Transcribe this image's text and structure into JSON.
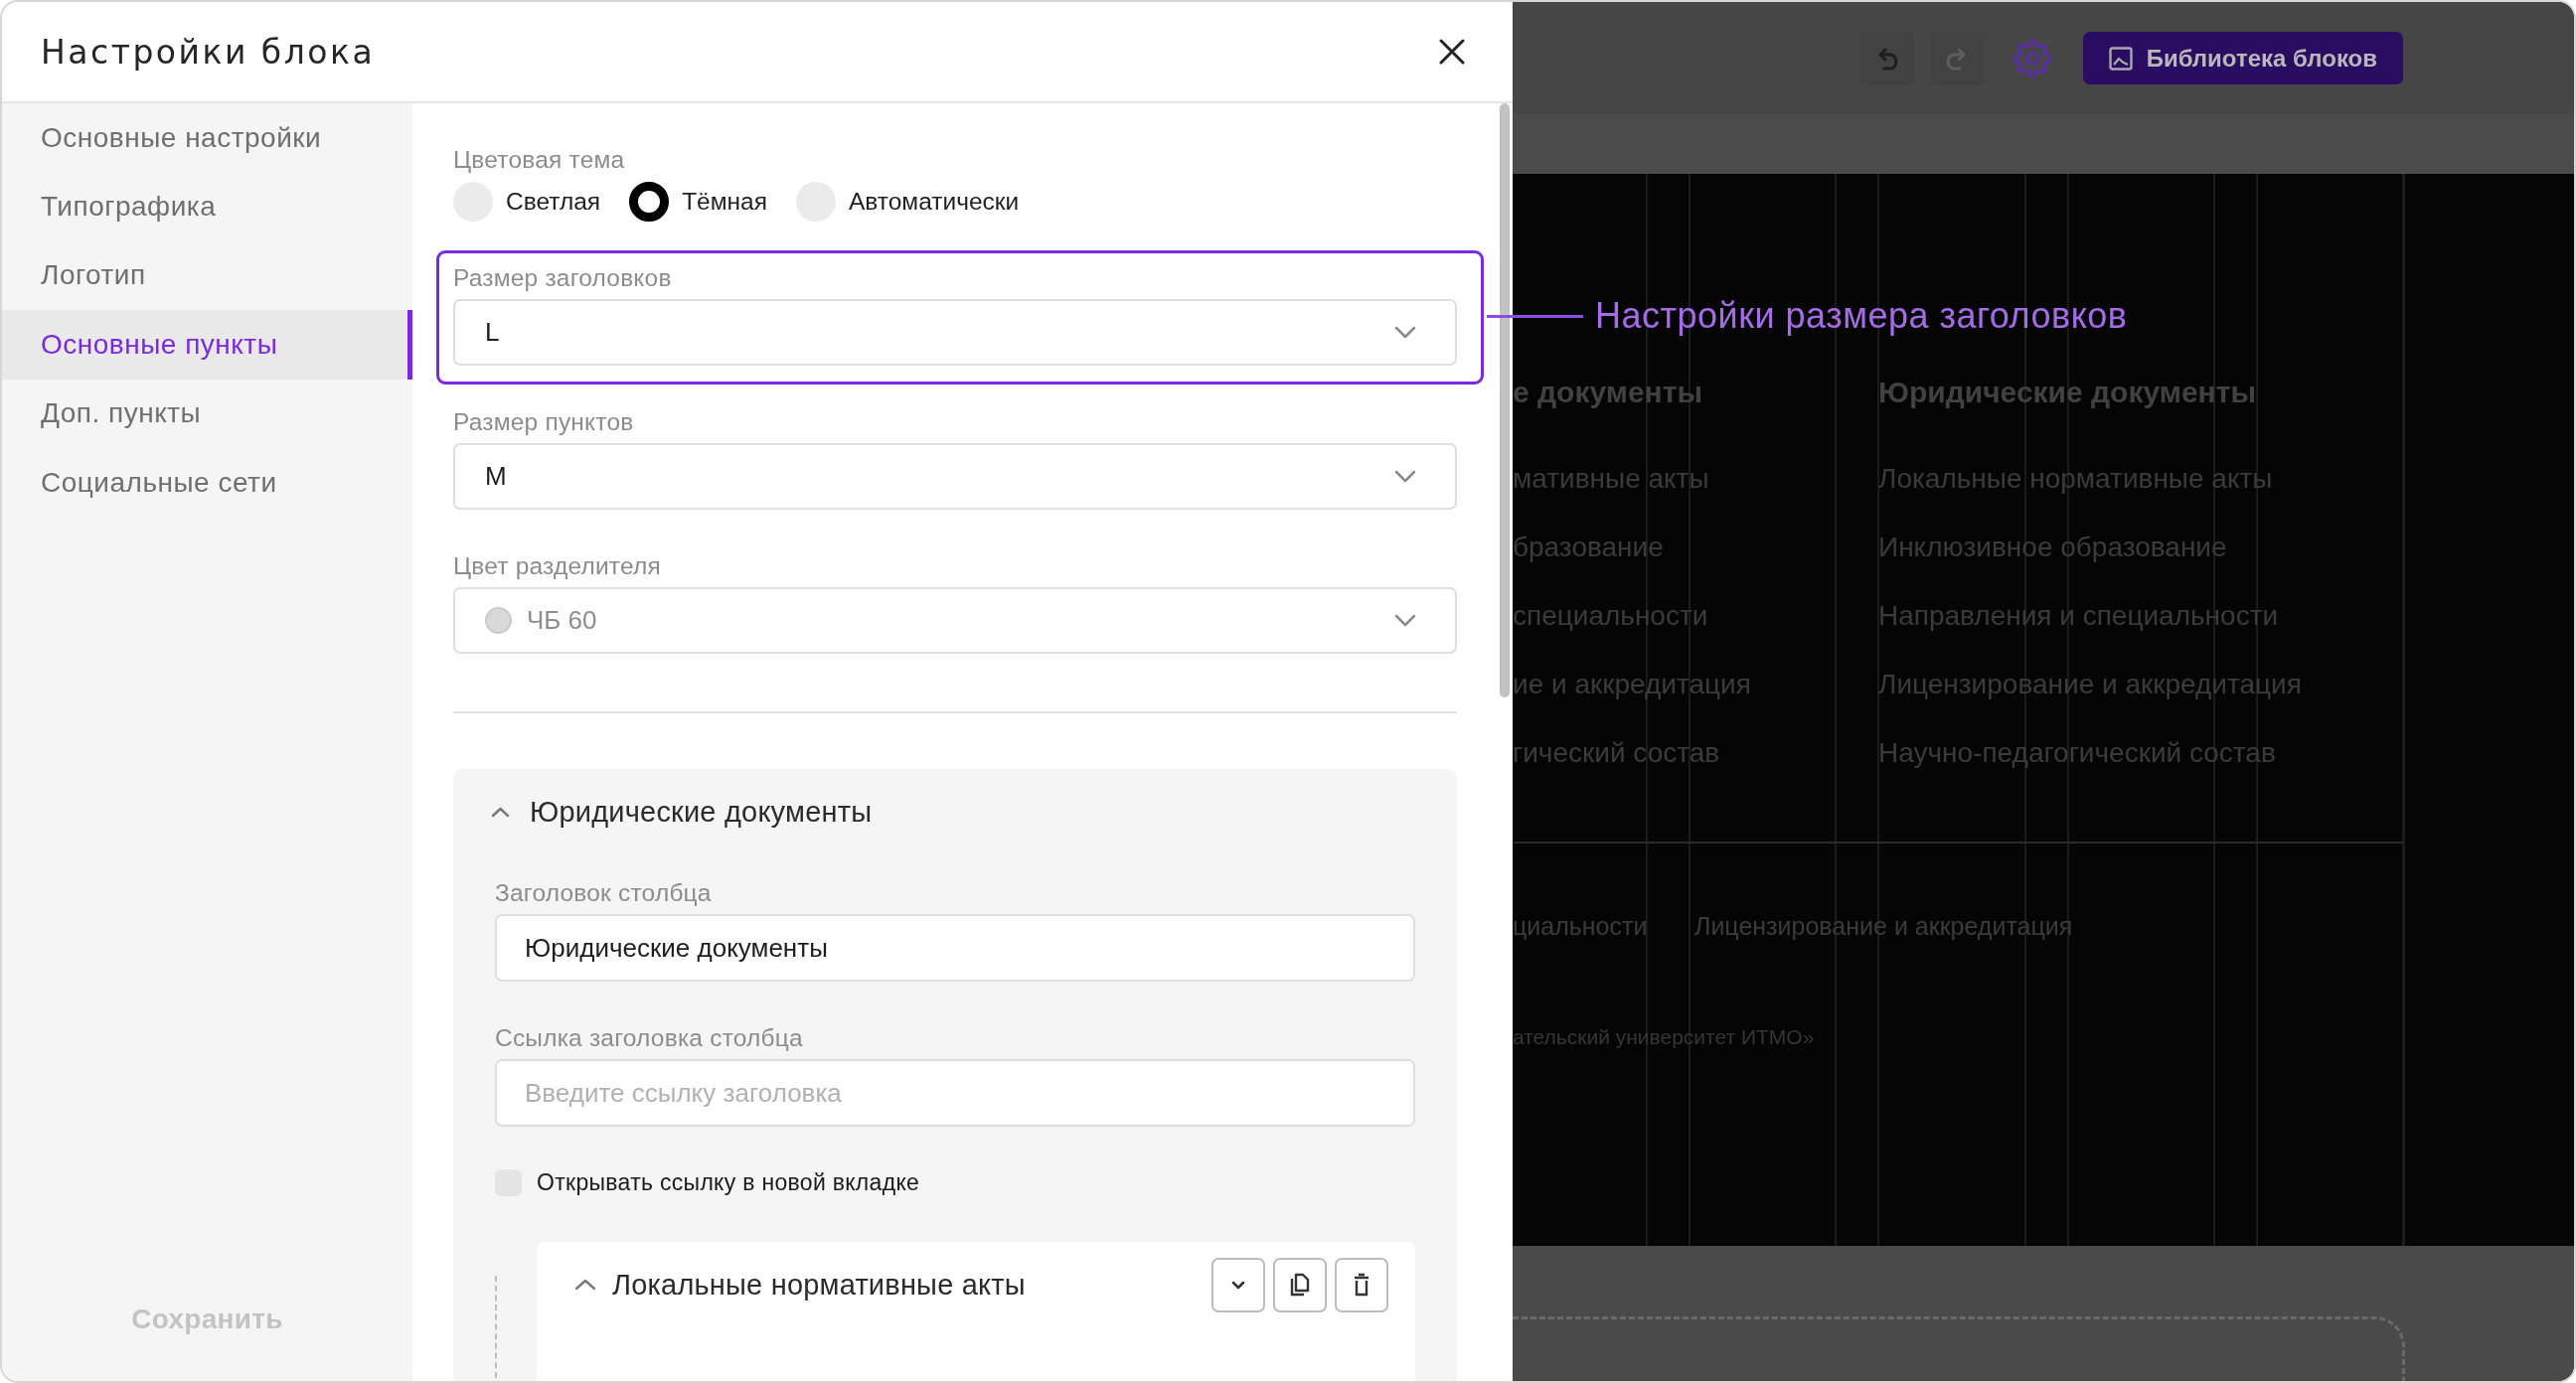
{
  "dialog": {
    "title": "Настройки блока"
  },
  "sidebar": {
    "items": [
      {
        "label": "Основные настройки",
        "selected": false
      },
      {
        "label": "Типографика",
        "selected": false
      },
      {
        "label": "Логотип",
        "selected": false
      },
      {
        "label": "Основные пункты",
        "selected": true
      },
      {
        "label": "Доп. пункты",
        "selected": false
      },
      {
        "label": "Социальные сети",
        "selected": false
      }
    ],
    "save_button": "Сохранить"
  },
  "settings": {
    "color_theme": {
      "label": "Цветовая тема",
      "options": [
        {
          "label": "Светлая",
          "selected": false
        },
        {
          "label": "Тёмная",
          "selected": true
        },
        {
          "label": "Автоматически",
          "selected": false
        }
      ]
    },
    "selects": [
      {
        "kind": "text",
        "label": "Размер заголовков",
        "value": "L",
        "highlighted": true
      },
      {
        "kind": "text",
        "label": "Размер пунктов",
        "value": "M",
        "highlighted": false
      },
      {
        "kind": "color",
        "label": "Цвет разделителя",
        "value": "ЧБ 60",
        "color": "#d9d9d9",
        "highlighted": false
      }
    ]
  },
  "column_section": {
    "title": "Юридические документы",
    "expanded": true,
    "fields": [
      {
        "label": "Заголовок столбца",
        "value": "Юридические документы"
      },
      {
        "label": "Ссылка заголовка столбца",
        "placeholder": "Введите ссылку заголовка"
      }
    ],
    "new_tab_checkbox": {
      "label": "Открывать ссылку в новой вкладке",
      "checked": false
    },
    "links": [
      {
        "title": "Локальные нормативные акты",
        "expanded": true
      }
    ]
  },
  "annotation": {
    "text": "Настройки размера заголовков"
  },
  "editor": {
    "toolbar": {
      "history": [
        {
          "kind": "undo",
          "disabled": false
        },
        {
          "kind": "redo",
          "disabled": true
        }
      ],
      "library_button": "Библиотека блоков"
    },
    "columns": [
      {
        "heading": "е документы",
        "items": [
          "мативные акты",
          "бразование",
          "специальности",
          "ие и аккредитация",
          "гический состав"
        ]
      },
      {
        "heading": "Юридические документы",
        "items": [
          "Локальные нормативные акты",
          "Инклюзивное образование",
          "Направления и специальности",
          "Лицензирование и аккредитация",
          "Научно-педагогический состав"
        ]
      }
    ],
    "footer_links": [
      "циальности",
      "Лицензирование и аккредитация"
    ],
    "footer_note": "ательский университет ИТМО»"
  }
}
